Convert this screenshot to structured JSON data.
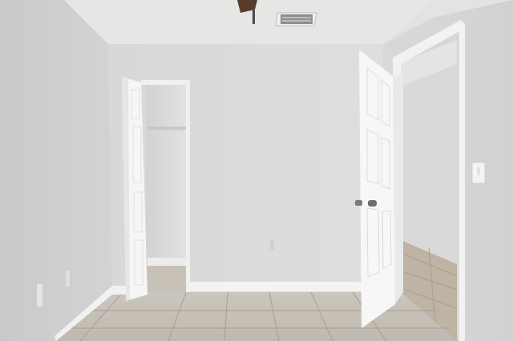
{
  "scene": {
    "kind": "empty bedroom interior photo",
    "colors": {
      "wall_light": "#dedede",
      "wall_left": "#cfcfcf",
      "wall_right": "#d6d6d6",
      "ceiling": "#e4e4e2",
      "door": "#f5f5f5",
      "trim": "#f2f2f2",
      "floor_tile": "#c4bfb6",
      "grout": "#aaa49b",
      "hall_floor": "#b9ae9f",
      "vent": "#9a9a9a",
      "fan": "#5a3a2c",
      "hardware": "#7a7a7a"
    }
  }
}
